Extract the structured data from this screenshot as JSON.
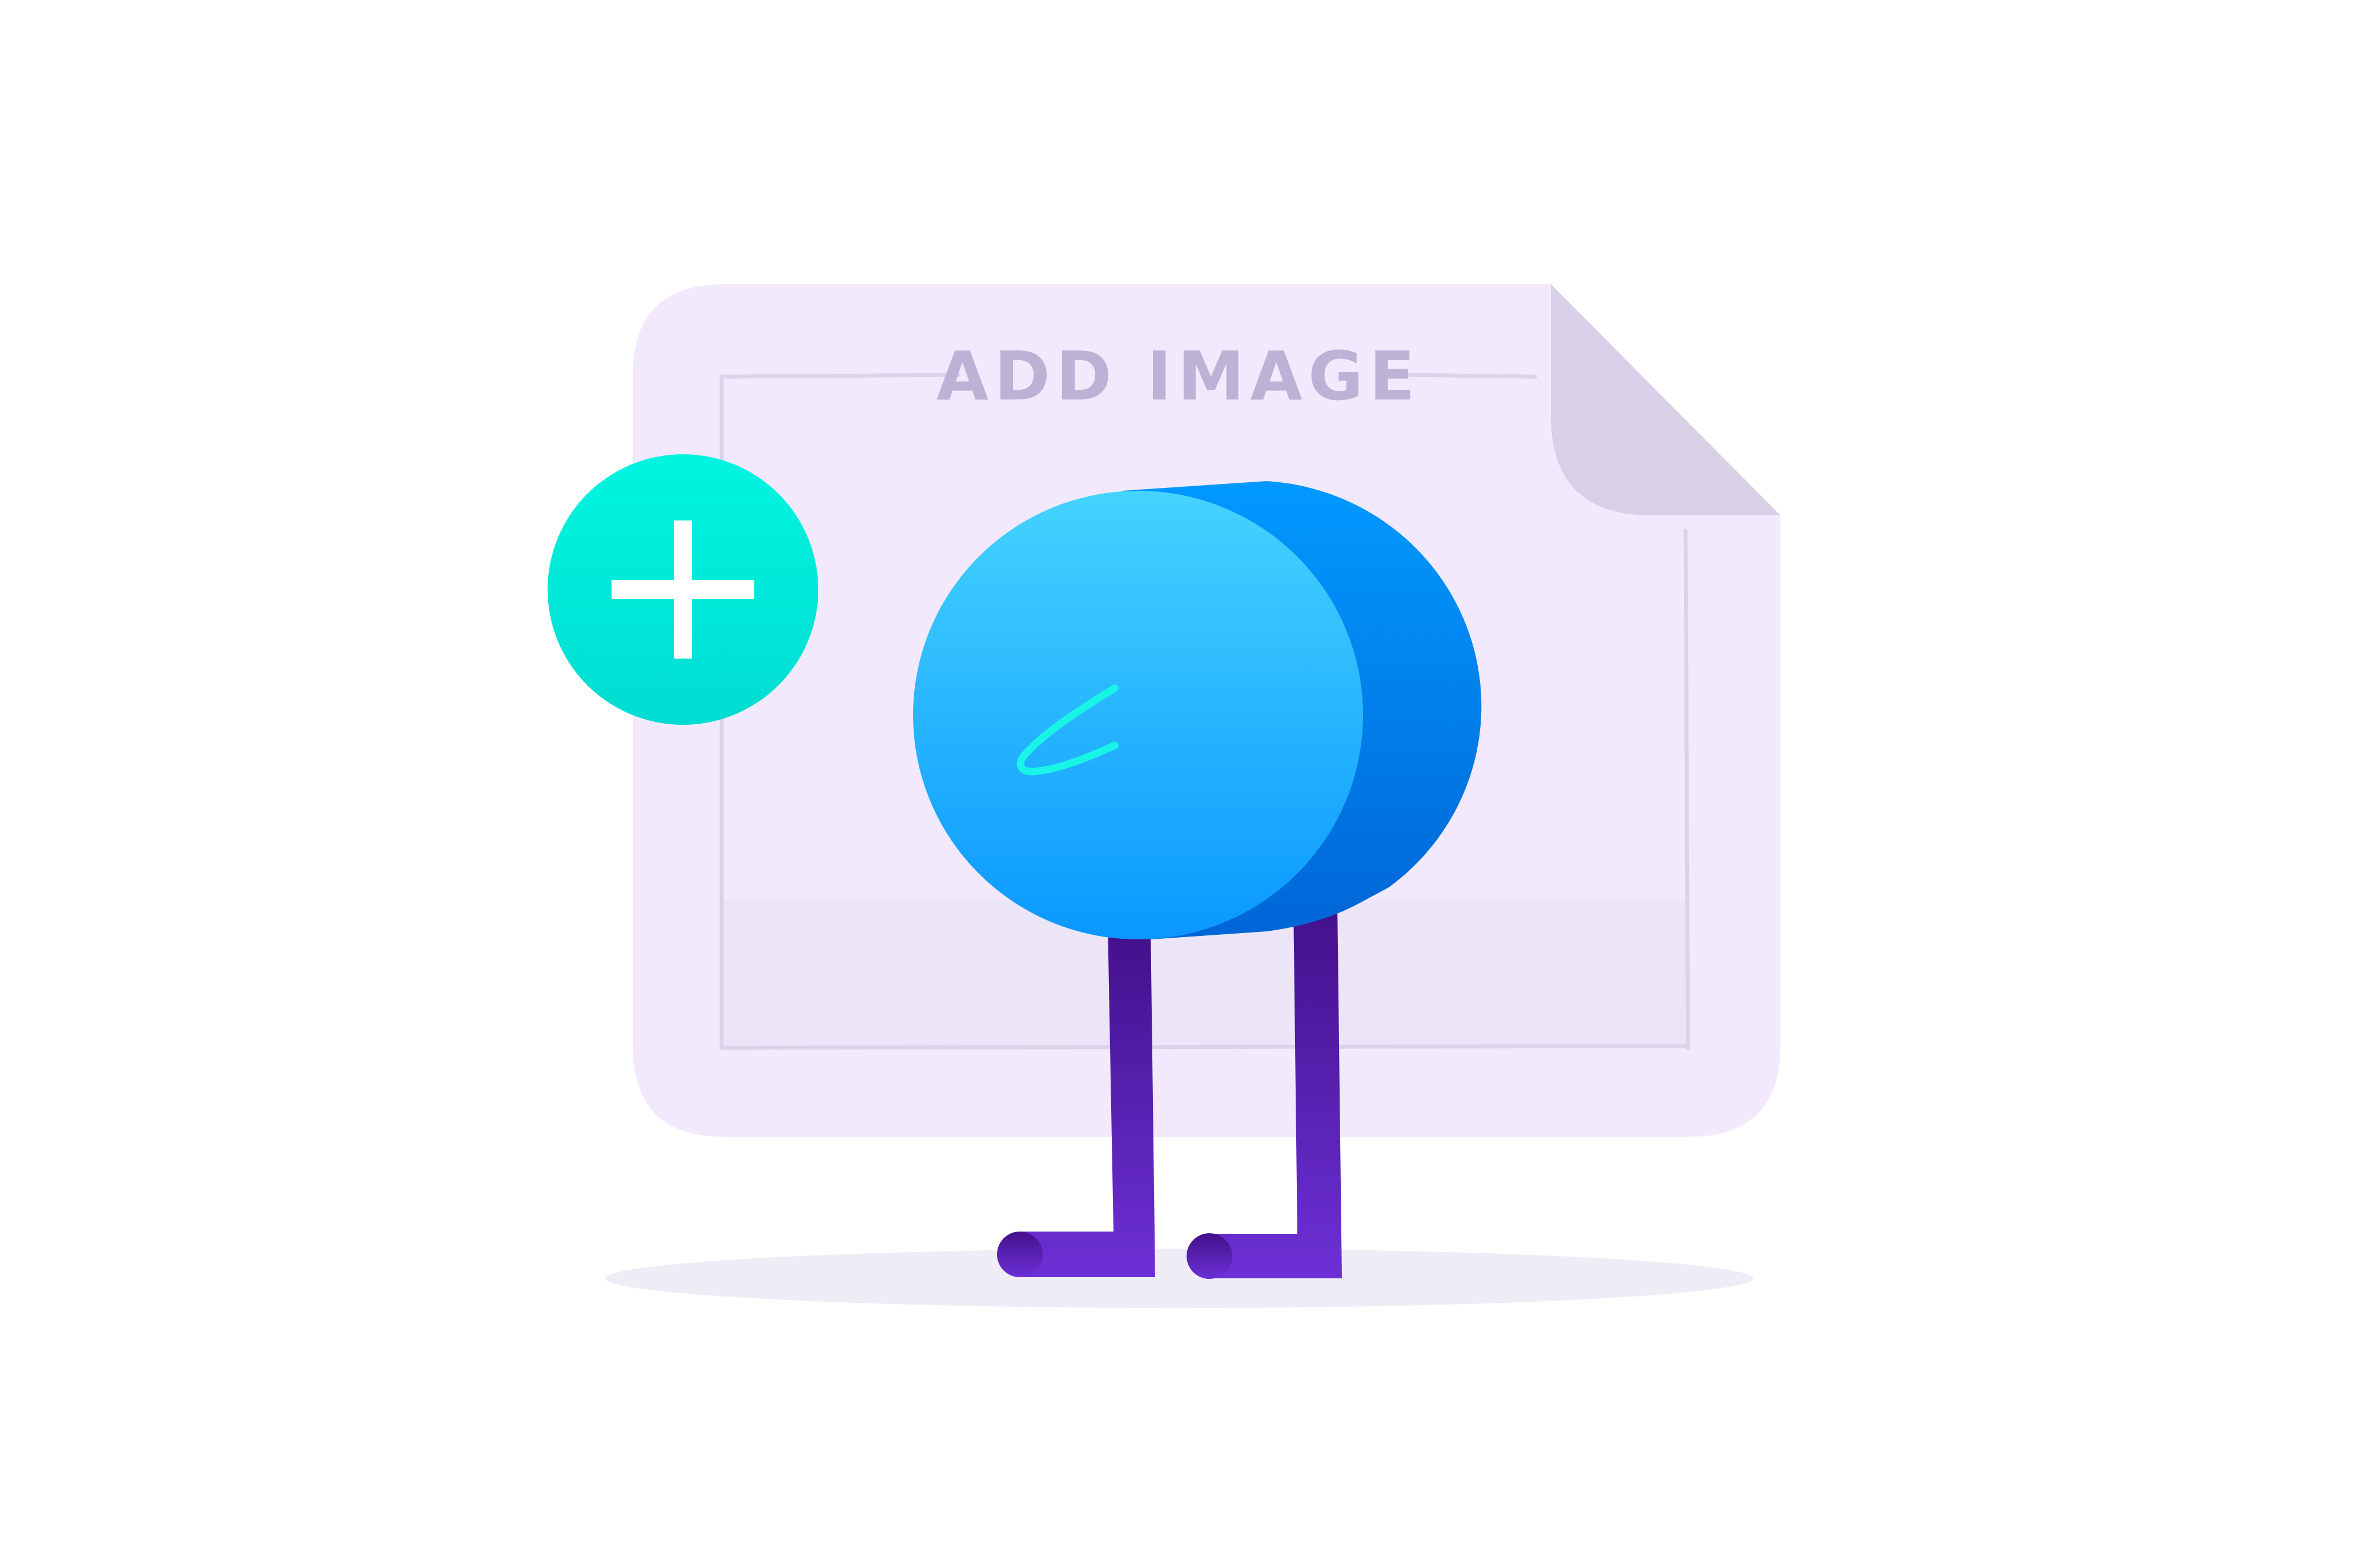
{
  "card": {
    "title": "ADD IMAGE"
  },
  "add_button": {
    "icon": "plus-icon"
  },
  "mascot": {
    "mark_icon": "signature-scribble-icon"
  },
  "colors": {
    "background": "#ffffff",
    "card_fill": "#f2eafc",
    "card_lower_fill": "#ece5f7",
    "fold": "#d9d0e7",
    "sketch_line": "#dcd2ea",
    "title": "#bdb2d6",
    "add_button_top": "#00f5e0",
    "add_button_bottom": "#00dcd2",
    "mascot_front_top": "#45d3ff",
    "mascot_front_bottom": "#0a98ff",
    "mascot_back_top": "#0199ff",
    "mascot_back_bottom": "#0065d6",
    "legs_top": "#43108a",
    "legs_bottom": "#6c30d6",
    "scribble": "#18f5e6",
    "shadow": "#efecf6"
  }
}
